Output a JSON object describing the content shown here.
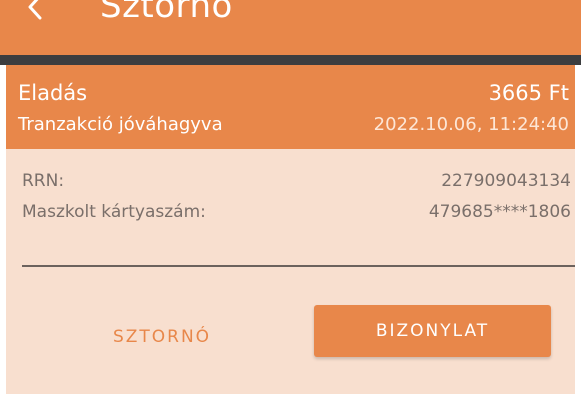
{
  "appbar": {
    "title": "Sztornó",
    "back_icon": "arrow-left-icon"
  },
  "transaction": {
    "type": "Eladás",
    "amount": "3665 Ft",
    "status": "Tranzakció jóváhagyva",
    "datetime": "2022.10.06, 11:24:40"
  },
  "details": {
    "rrn_label": "RRN:",
    "rrn_value": "227909043134",
    "card_label": "Maszkolt kártyaszám:",
    "card_value": "479685****1806"
  },
  "actions": {
    "void_label": "SZTORNÓ",
    "receipt_label": "BIZONYLAT"
  },
  "colors": {
    "accent": "#e8874a",
    "card_background": "#f8dfcf",
    "dark_strip": "#3c3d3f"
  }
}
